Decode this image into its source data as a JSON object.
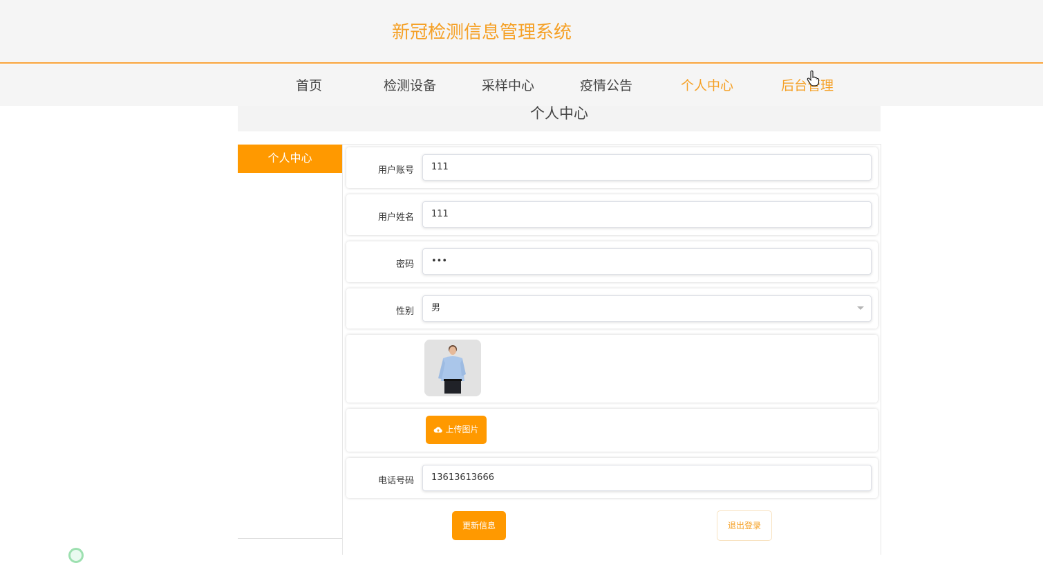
{
  "header": {
    "title": "新冠检测信息管理系统"
  },
  "nav": {
    "items": [
      {
        "label": "首页"
      },
      {
        "label": "检测设备"
      },
      {
        "label": "采样中心"
      },
      {
        "label": "疫情公告"
      },
      {
        "label": "个人中心"
      },
      {
        "label": "后台管理"
      }
    ],
    "active": "个人中心"
  },
  "page": {
    "title": "个人中心"
  },
  "sidebar": {
    "items": [
      {
        "label": "个人中心"
      }
    ]
  },
  "form": {
    "account": {
      "label": "用户账号",
      "value": "111"
    },
    "name": {
      "label": "用户姓名",
      "value": "111"
    },
    "password": {
      "label": "密码",
      "value": "•••"
    },
    "gender": {
      "label": "性别",
      "value": "男"
    },
    "upload": {
      "label": "上传图片"
    },
    "phone": {
      "label": "电话号码",
      "value": "13613613666"
    },
    "update_label": "更新信息",
    "logout_label": "退出登录"
  },
  "colors": {
    "accent": "#ff9900",
    "title": "#f5a025"
  }
}
